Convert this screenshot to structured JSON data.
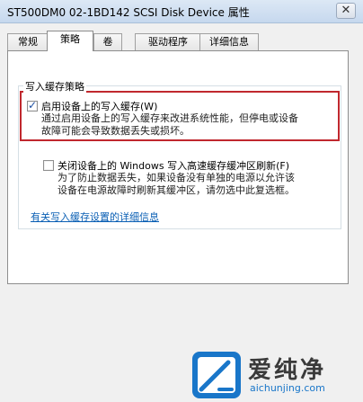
{
  "window": {
    "title": "ST500DM0 02-1BD142 SCSI Disk Device 属性",
    "close_label": "✕"
  },
  "tabs": [
    {
      "label": "常规",
      "active": false
    },
    {
      "label": "策略",
      "active": true
    },
    {
      "label": "卷",
      "active": false
    },
    {
      "label": "驱动程序",
      "active": false
    },
    {
      "label": "详细信息",
      "active": false
    }
  ],
  "write_cache": {
    "group_title": "写入缓存策略",
    "enable": {
      "label": "启用设备上的写入缓存(W)",
      "checked": true,
      "desc_line1": "通过启用设备上的写入缓存来改进系统性能，但停电或设备",
      "desc_line2": "故障可能会导致数据丢失或损坏。"
    },
    "flush": {
      "label": "关闭设备上的 Windows 写入高速缓存缓冲区刷新(F)",
      "checked": false,
      "desc_line1": "为了防止数据丢失，如果设备没有单独的电源以允许该",
      "desc_line2": "设备在电源故障时刷新其缓冲区，请勿选中此复选框。"
    },
    "details_link": "有关写入缓存设置的详细信息"
  },
  "watermark": {
    "brand": "爱纯净",
    "url": "aichunjing.com"
  },
  "colors": {
    "highlight": "#c0282e",
    "link": "#0a5fb4",
    "brand": "#1976c9"
  }
}
